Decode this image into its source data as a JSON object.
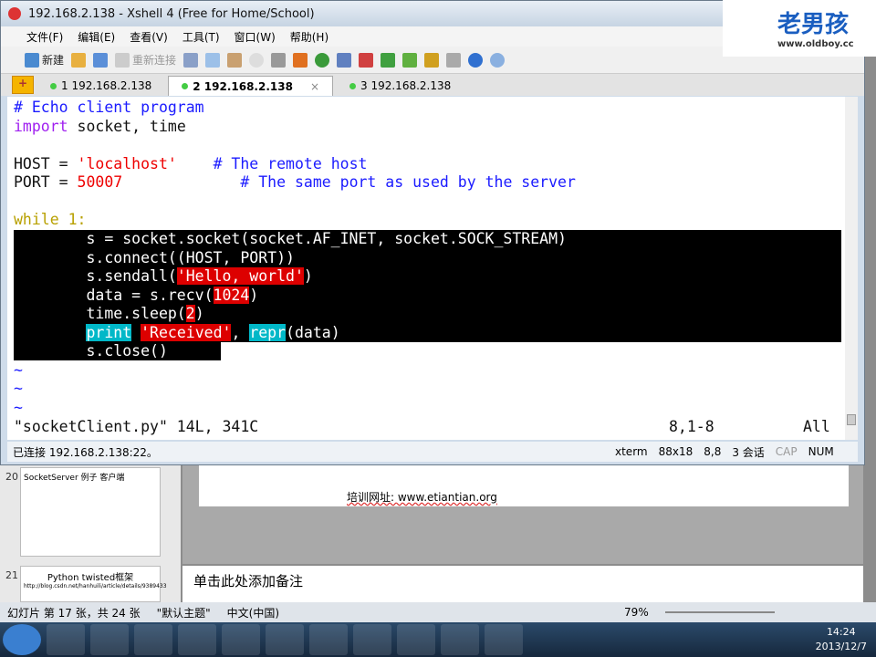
{
  "window": {
    "title": "192.168.2.138 - Xshell 4 (Free for Home/School)"
  },
  "menu": [
    "文件(F)",
    "编辑(E)",
    "查看(V)",
    "工具(T)",
    "窗口(W)",
    "帮助(H)"
  ],
  "toolbar": {
    "new_label": "新建",
    "reconnect_label": "重新连接"
  },
  "tabs": [
    {
      "label": "1 192.168.2.138"
    },
    {
      "label": "2 192.168.2.138"
    },
    {
      "label": "3 192.168.2.138"
    }
  ],
  "terminal": {
    "l1": "# Echo client program",
    "l2a": "import",
    "l2b": " socket, time",
    "l3a": "HOST = ",
    "l3b": "'localhost'",
    "l3c": "    # The remote host",
    "l4a": "PORT = ",
    "l4b": "50007",
    "l4c": "             # The same port as used by the server",
    "l5a": "while",
    "l5b": " 1:",
    "l6": "        s = socket.socket(socket.AF_INET, socket.SOCK_STREAM)",
    "l7": "        s.connect((HOST, PORT))",
    "l8a": "        s.sendall(",
    "l8b": "'Hello, world'",
    "l8c": ")",
    "l9a": "        data = s.recv(",
    "l9b": "1024",
    "l9c": ")",
    "l10a": "        time.sleep(",
    "l10b": "2",
    "l10c": ")",
    "l11a": "        ",
    "l11b": "print",
    "l11c": " ",
    "l11d": "'Received'",
    "l11e": ", ",
    "l11f": "repr",
    "l11g": "(data)",
    "l12": "        s.close()",
    "tilde": "~",
    "file_info": "\"socketClient.py\" 14L, 341C",
    "position": "8,1-8",
    "scroll": "All"
  },
  "status": {
    "connection": "已连接 192.168.2.138:22。",
    "term": "xterm",
    "size": "88x18",
    "cursor": "8,8",
    "sessions": "3 会话",
    "cap": "CAP",
    "num": "NUM"
  },
  "logo": {
    "text": "老男孩",
    "sub": "www.oldboy.cc"
  },
  "ppt": {
    "slide20_num": "20",
    "slide20_title": "SocketServer 例子 客户端",
    "slide21_num": "21",
    "slide21_title": "Python twisted框架",
    "slide21_text": "http://blog.csdn.net/hanhuili/article/details/9389433",
    "slide_text": "培训网址: www.etiantian.org",
    "notes": "单击此处添加备注",
    "status_slide": "幻灯片 第 17 张，共 24 张",
    "status_theme": "\"默认主题\"",
    "status_lang": "中文(中国)",
    "zoom": "79%"
  },
  "clock": {
    "time": "14:24",
    "date": "2013/12/7"
  }
}
